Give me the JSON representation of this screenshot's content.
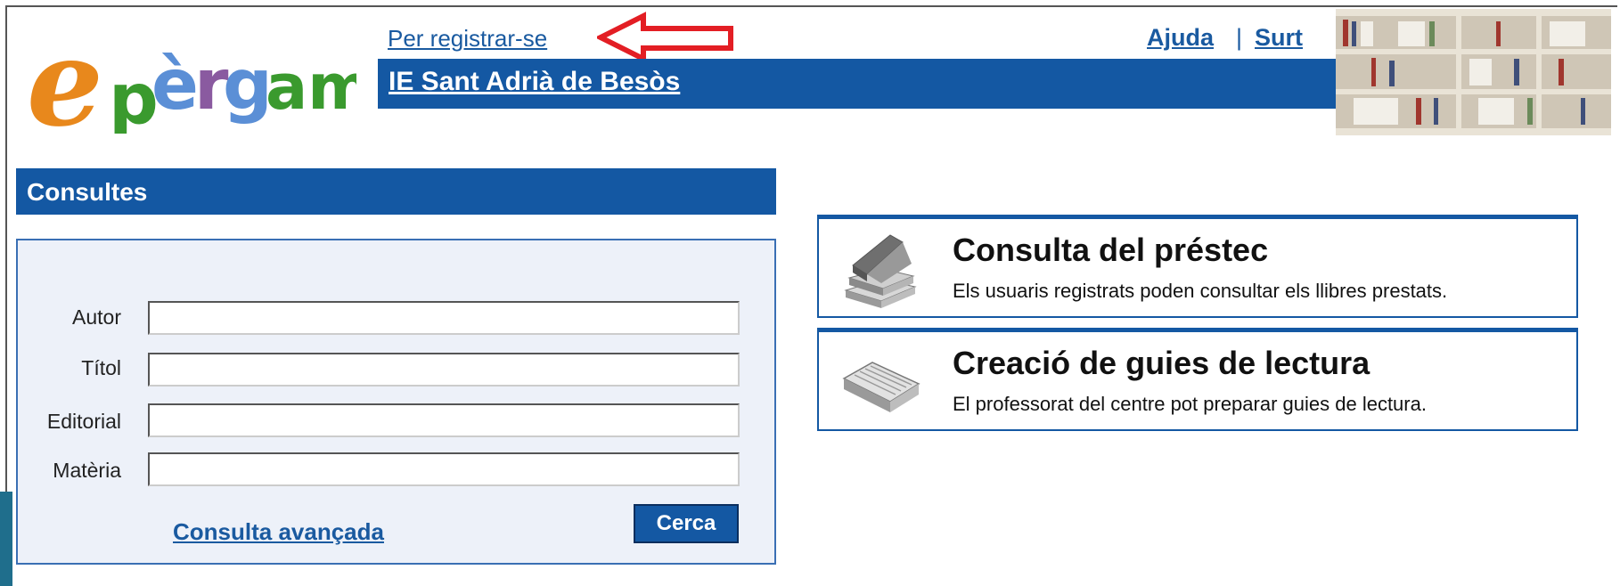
{
  "brand": {
    "logo_text": "epèrgam",
    "colors": {
      "e": "#e8881c",
      "p": "#3a9a2e",
      "erg": "#5b8fd6",
      "am": "#3a9a2e",
      "accent": "#1458a3"
    }
  },
  "header": {
    "register_label": "Per registrar-se",
    "help_label": "Ajuda",
    "separator": "|",
    "exit_label": "Surt",
    "school_name": "IE Sant Adrià de Besòs"
  },
  "search_panel": {
    "title": "Consultes",
    "fields": [
      {
        "label": "Autor",
        "value": ""
      },
      {
        "label": "Títol",
        "value": ""
      },
      {
        "label": "Editorial",
        "value": ""
      },
      {
        "label": "Matèria",
        "value": ""
      }
    ],
    "advanced_link": "Consulta avançada",
    "search_button": "Cerca"
  },
  "cards": [
    {
      "title": "Consulta del préstec",
      "description": "Els usuaris registrats poden consultar els llibres prestats.",
      "icon": "books-stack-icon"
    },
    {
      "title": "Creació de guies de lectura",
      "description": "El professorat del centre pot preparar guies de lectura.",
      "icon": "open-book-icon"
    }
  ]
}
